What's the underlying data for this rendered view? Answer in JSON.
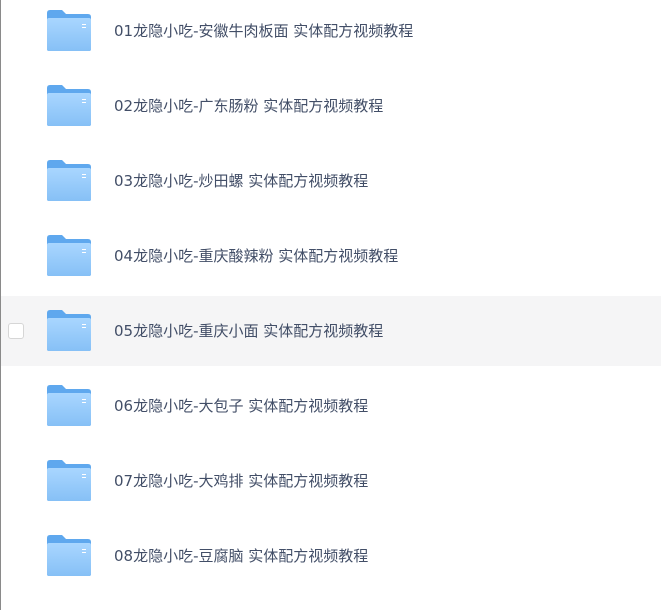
{
  "file_list": {
    "hovered_index": 4,
    "icon": "folder-icon",
    "colors": {
      "folder_back": "#5fa8ee",
      "folder_front_top": "#a9d6ff",
      "folder_front_bottom": "#86c0f6",
      "text": "#424e67",
      "hover_bg": "#f5f5f6"
    },
    "items": [
      {
        "name": "01龙隐小吃-安徽牛肉板面 实体配方视频教程"
      },
      {
        "name": "02龙隐小吃-广东肠粉 实体配方视频教程"
      },
      {
        "name": "03龙隐小吃-炒田螺 实体配方视频教程"
      },
      {
        "name": "04龙隐小吃-重庆酸辣粉 实体配方视频教程"
      },
      {
        "name": "05龙隐小吃-重庆小面 实体配方视频教程"
      },
      {
        "name": "06龙隐小吃-大包子 实体配方视频教程"
      },
      {
        "name": "07龙隐小吃-大鸡排 实体配方视频教程"
      },
      {
        "name": "08龙隐小吃-豆腐脑 实体配方视频教程"
      }
    ]
  }
}
